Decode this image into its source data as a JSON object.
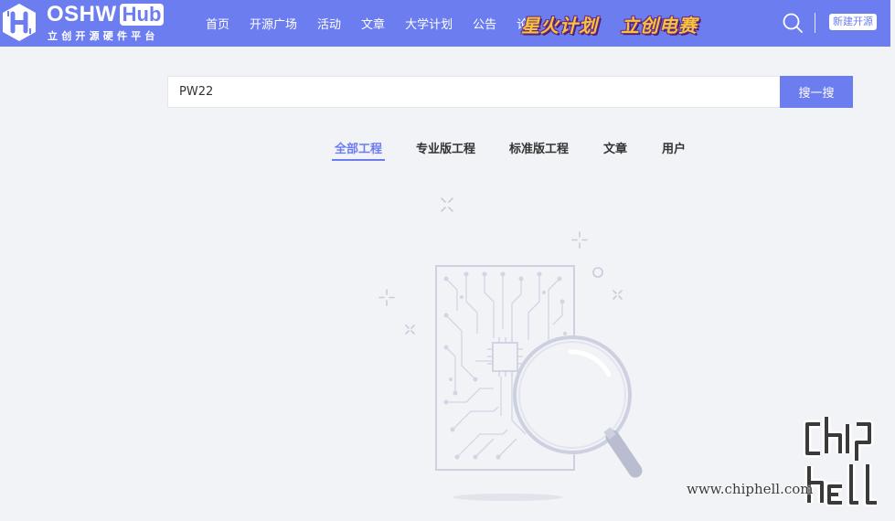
{
  "header": {
    "logo_word": "OSHW",
    "logo_hub": "Hub",
    "logo_subtitle": "立创开源硬件平台",
    "nav": [
      "首页",
      "开源广场",
      "活动",
      "文章",
      "大学计划",
      "公告",
      "论坛"
    ],
    "promo_1": "星火计划",
    "promo_2": "立创电赛",
    "new_button": "新建开源",
    "icons": {
      "logo": "logo-icon",
      "search": "search-icon"
    },
    "colors": {
      "brand": "#6c7df0",
      "promo_fill": "#f7c23c",
      "promo_outline": "#6b2a86"
    }
  },
  "search": {
    "value": "PW22",
    "button": "搜一搜"
  },
  "tabs": {
    "items": [
      "全部工程",
      "专业版工程",
      "标准版工程",
      "文章",
      "用户"
    ],
    "active": "全部工程"
  },
  "illustration": {
    "icon": "empty-search-result-icon"
  },
  "watermark": {
    "logo_text": "chiphell",
    "url": "www.chiphell.com"
  }
}
